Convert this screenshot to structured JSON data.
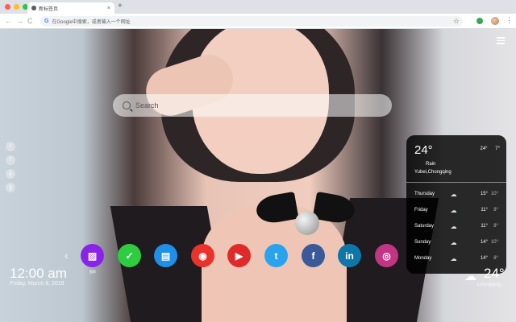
{
  "browser": {
    "tab_title": "新标签页",
    "tab_close": "×",
    "new_tab": "+",
    "address_placeholder": "在Google中搜索，或者输入一个网址",
    "back": "←",
    "forward": "→",
    "reload": "C",
    "star": "☆",
    "menu": "⋮"
  },
  "search": {
    "placeholder": "Search"
  },
  "share": [
    "t",
    "f",
    "p",
    "g"
  ],
  "weather": {
    "temp": "24°",
    "high": "24°",
    "low": "7°",
    "condition": "Rain",
    "location": "Yubei,Chongqing",
    "forecast": [
      {
        "day": "Thursday",
        "icon": "☁",
        "high": "15°",
        "low": "10°"
      },
      {
        "day": "Friday",
        "icon": "☁",
        "high": "11°",
        "low": "8°"
      },
      {
        "day": "Saturday",
        "icon": "☁",
        "high": "11°",
        "low": "8°"
      },
      {
        "day": "Sunday",
        "icon": "☁",
        "high": "14°",
        "low": "10°"
      },
      {
        "day": "Monday",
        "icon": "☁",
        "high": "14°",
        "low": "8°"
      }
    ]
  },
  "apps": {
    "prev_arrow": "‹",
    "items": [
      {
        "name": "wallpaper",
        "glyph": "▨",
        "label": "图库",
        "color": "#8a23e8"
      },
      {
        "name": "todo",
        "glyph": "✓",
        "label": "",
        "color": "#2ecc40"
      },
      {
        "name": "notes",
        "glyph": "▤",
        "label": "",
        "color": "#1e90e8"
      },
      {
        "name": "game",
        "glyph": "◉",
        "label": "",
        "color": "#e8322a"
      },
      {
        "name": "youtube",
        "glyph": "▶",
        "label": "",
        "color": "#e02a2a"
      },
      {
        "name": "twitter",
        "glyph": "t",
        "label": "",
        "color": "#2aa3ef"
      },
      {
        "name": "facebook",
        "glyph": "f",
        "label": "",
        "color": "#3b5998"
      },
      {
        "name": "linkedin",
        "glyph": "in",
        "label": "",
        "color": "#0e76a8"
      },
      {
        "name": "instagram",
        "glyph": "◎",
        "label": "",
        "color": "#c13584"
      }
    ]
  },
  "clock": {
    "time": "12:00 am",
    "date": "Friday, March 8, 2019"
  },
  "weather_mini": {
    "icon": "☁",
    "temp": "24°",
    "city": "Chongqing"
  }
}
